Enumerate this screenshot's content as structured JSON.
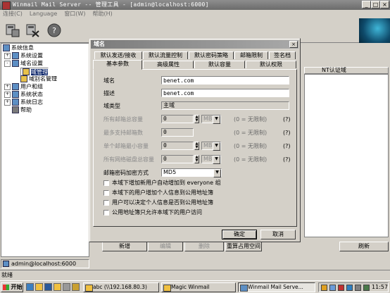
{
  "window": {
    "title": "Winmail Mail Server -- 管理工具 - [admin@localhost:6000]",
    "min": "_",
    "max": "□",
    "close": "×"
  },
  "menu": [
    "连接(C)",
    "Language",
    "窗口(W)",
    "帮助(H)"
  ],
  "tree": {
    "root": "系统信息",
    "items": [
      "系统设置",
      "域名设置",
      "域管理",
      "域别名管理",
      "用户和组",
      "系统状态",
      "系统日志",
      "帮助"
    ]
  },
  "list": {
    "column": "NT认证域"
  },
  "bottom_buttons": {
    "add": "新增",
    "edit": "编辑",
    "delete": "删除",
    "recalc": "重算占用空间",
    "refresh": "刷新"
  },
  "status": {
    "connection": "admin@localhost:6000",
    "ready": "就绪"
  },
  "dialog": {
    "title": "域名",
    "tabs_row1": [
      "默认发送/接收",
      "默认流量控制",
      "默认密码策略",
      "邮箱限制",
      "签名档"
    ],
    "tabs_row2": [
      "基本参数",
      "高级属性",
      "默认容量",
      "默认权限"
    ],
    "fields": {
      "domain_label": "域名",
      "domain_value": "benet.com",
      "desc_label": "描述",
      "desc_value": "benet.com",
      "type_label": "域类型",
      "type_value": "主域",
      "max_mailbox_size_label": "所有邮箱总容量",
      "max_mailbox_size_value": "0",
      "max_mailbox_size_unit": "MB",
      "max_mailbox_count_label": "最多支持邮箱数",
      "max_mailbox_count_value": "0",
      "single_mailbox_label": "单个邮箱最小容量",
      "single_mailbox_value": "0",
      "single_mailbox_unit": "MB",
      "netdisk_label": "所有网络磁盘总容量",
      "netdisk_value": "0",
      "netdisk_unit": "MB",
      "unlimited_note": "(0 = 无限制)",
      "help_mark": "(?)",
      "encrypt_label": "邮箱密码加密方式",
      "encrypt_value": "MD5"
    },
    "checkboxes": [
      "本域下增加新用户自动增加到 everyone 组",
      "本域下的用户增加个人信息到公用地址簿",
      "用户可以决定个人信息是否到公用地址簿",
      "公用地址簿只允许本域下的用户访问"
    ],
    "ok": "确定",
    "cancel": "取消"
  },
  "taskbar": {
    "start": "开始",
    "tasks": [
      "abc (\\\\192.168.80.3)",
      "Magic Winmail",
      "Winmail Mail Serve..."
    ],
    "clock": "11:57"
  }
}
